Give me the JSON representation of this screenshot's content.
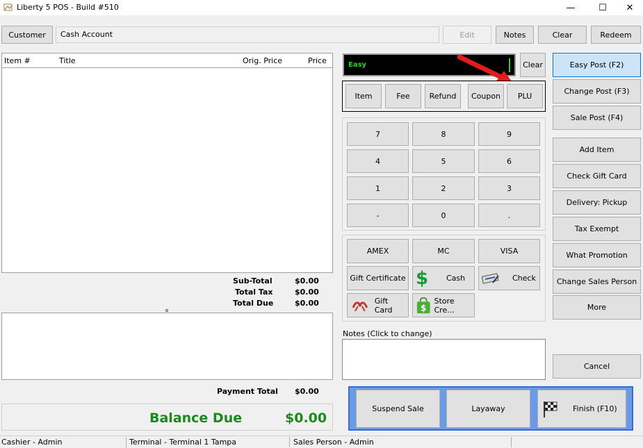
{
  "window": {
    "title": "Liberty 5 POS - Build #510",
    "minimize": "—",
    "maximize": "☐",
    "close": "✕"
  },
  "header": {
    "customer_button": "Customer",
    "customer_value": "Cash Account",
    "edit_button": "Edit",
    "notes_button": "Notes",
    "clear_button": "Clear",
    "redeem_button": "Redeem"
  },
  "items_table": {
    "columns": [
      "Item #",
      "Title",
      "Orig. Price",
      "Price"
    ],
    "rows": []
  },
  "totals": {
    "subtotal_label": "Sub-Total",
    "subtotal_value": "$0.00",
    "tax_label": "Total Tax",
    "tax_value": "$0.00",
    "due_label": "Total Due",
    "due_value": "$0.00",
    "payment_total_label": "Payment Total",
    "payment_total_value": "$0.00",
    "balance_label": "Balance Due",
    "balance_value": "$0.00"
  },
  "display": {
    "text": "Easy",
    "clear_button": "Clear"
  },
  "mode_buttons": [
    "Item",
    "Fee",
    "Refund",
    "Coupon",
    "PLU"
  ],
  "keypad": [
    "7",
    "8",
    "9",
    "4",
    "5",
    "6",
    "1",
    "2",
    "3",
    "-",
    "0",
    "."
  ],
  "tenders": {
    "amex": "AMEX",
    "mc": "MC",
    "visa": "VISA",
    "gift_certificate": "Gift Certificate",
    "cash": "Cash",
    "check": "Check",
    "gift_card": "Gift Card",
    "store_credit": "Store Cre..."
  },
  "notes": {
    "label": "Notes (Click to change)"
  },
  "post_buttons": {
    "easy": "Easy Post (F2)",
    "change": "Change Post (F3)",
    "sale": "Sale Post (F4)"
  },
  "action_buttons": [
    "Add Item",
    "Check Gift Card",
    "Delivery: Pickup",
    "Tax Exempt",
    "What Promotion",
    "Change Sales Person",
    "More"
  ],
  "cancel_button": "Cancel",
  "bottom_buttons": {
    "suspend": "Suspend Sale",
    "layaway": "Layaway",
    "finish": "Finish (F10)"
  },
  "status_bar": {
    "cashier": "Cashier - Admin",
    "terminal": "Terminal - Terminal 1 Tampa",
    "sales_person": "Sales Person - Admin"
  },
  "colors": {
    "accent": "#0078d7",
    "balance": "#1b8a1b",
    "display_text": "#28d628",
    "bottom_panel": "#6b9ae6",
    "annotation_arrow": "#e31b1b"
  }
}
